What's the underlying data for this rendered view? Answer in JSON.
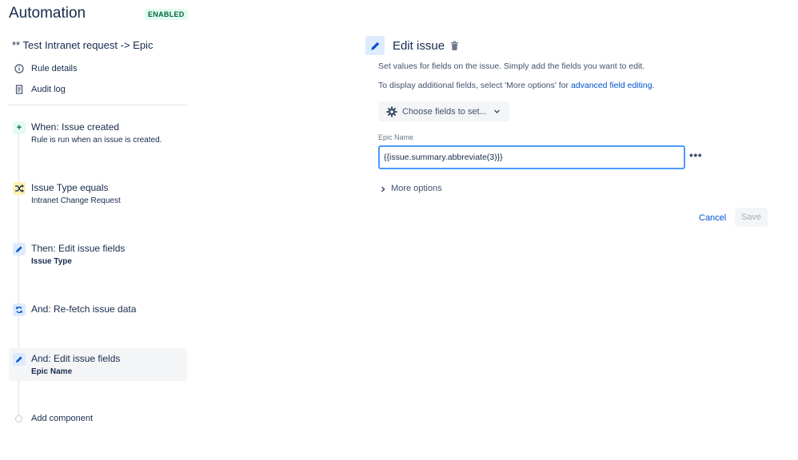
{
  "header": {
    "title": "Automation",
    "status_badge": "ENABLED"
  },
  "sidebar": {
    "rule_name": "** Test Intranet request -> Epic",
    "nav": [
      {
        "label": "Rule details",
        "icon": "info-icon"
      },
      {
        "label": "Audit log",
        "icon": "document-icon"
      }
    ],
    "components": [
      {
        "title": "When: Issue created",
        "subtitle": "Rule is run when an issue is created.",
        "icon": "plus-icon",
        "type": "trigger"
      },
      {
        "title": "Issue Type equals",
        "subtitle": "Intranet Change Request",
        "icon": "shuffle-icon",
        "type": "condition"
      },
      {
        "title": "Then: Edit issue fields",
        "subtitle": "Issue Type",
        "icon": "pencil-icon",
        "type": "action"
      },
      {
        "title": "And: Re-fetch issue data",
        "subtitle": "",
        "icon": "refresh-icon",
        "type": "action"
      },
      {
        "title": "And: Edit issue fields",
        "subtitle": "Epic Name",
        "icon": "pencil-icon",
        "type": "action",
        "selected": true
      }
    ],
    "add_component_label": "Add component"
  },
  "editor": {
    "title": "Edit issue",
    "description_line1": "Set values for fields on the issue. Simply add the fields you want to edit.",
    "description_line2_prefix": "To display additional fields, select 'More options' for ",
    "description_link": "advanced field editing",
    "description_line2_suffix": ".",
    "choose_fields_label": "Choose fields to set...",
    "field": {
      "label": "Epic Name",
      "value": "{{issue.summary.abbreviate(3)}}"
    },
    "more_options_label": "More options",
    "cancel_label": "Cancel",
    "save_label": "Save"
  },
  "colors": {
    "accent": "#0052cc",
    "focus_border": "#4c9aff",
    "enabled_badge_bg": "#e3fcef",
    "enabled_badge_text": "#006644"
  }
}
